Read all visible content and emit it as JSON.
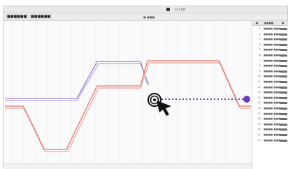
{
  "window": {
    "title": "ini.txt"
  },
  "toolbar": {
    "item1": "■■■■■■ ",
    "item2": "■■■■■■",
    "column_label": "■ ■■■"
  },
  "panel": {
    "headers": [
      "■",
      "■■■■",
      "■"
    ],
    "rows": [
      {
        "idx": "1",
        "val": "■■■■ ■■■"
      },
      {
        "idx": "2",
        "val": "■■■■ ■■■"
      },
      {
        "idx": "3",
        "val": "■■■■ ■■■"
      },
      {
        "idx": "4",
        "val": "■■■■ ■■■"
      },
      {
        "idx": "5",
        "val": "■■■■ ■■■"
      },
      {
        "idx": "6",
        "val": "■■■■ ■■■"
      },
      {
        "idx": "7",
        "val": "■■■■ ■■■"
      },
      {
        "idx": "8",
        "val": "■■■■ ■■■"
      },
      {
        "idx": "9",
        "val": "■■■■ ■■■"
      },
      {
        "idx": "10",
        "val": "■■■■ ■■■"
      },
      {
        "idx": "11",
        "val": "■■■■ ■■■"
      },
      {
        "idx": "12",
        "val": "■■■■ ■■■"
      },
      {
        "idx": "13",
        "val": "■■■■ ■■■"
      },
      {
        "idx": "14",
        "val": "■■■■ ■■■"
      },
      {
        "idx": "15",
        "val": "■■■■ ■■■"
      },
      {
        "idx": "16",
        "val": "■■■■ ■■■"
      },
      {
        "idx": "17",
        "val": "■■■■ ■■■"
      },
      {
        "idx": "18",
        "val": "■■■■ ■■■"
      },
      {
        "idx": "19",
        "val": "■■■■ ■■■"
      },
      {
        "idx": "20",
        "val": "■■■■ ■■■"
      },
      {
        "idx": "21",
        "val": "■■■■ ■■■"
      },
      {
        "idx": "22",
        "val": "■■■■ ■■■"
      }
    ]
  },
  "colors": {
    "purple_line": "#9b7fc9",
    "red_line": "#e0766e",
    "marker": "#6a3fbf",
    "cursor": "#111111"
  },
  "icons": {
    "cursor": "arrow-pointer-icon",
    "drag_handle": "concentric-ring-icon",
    "endpoint": "circle-handle-icon"
  }
}
